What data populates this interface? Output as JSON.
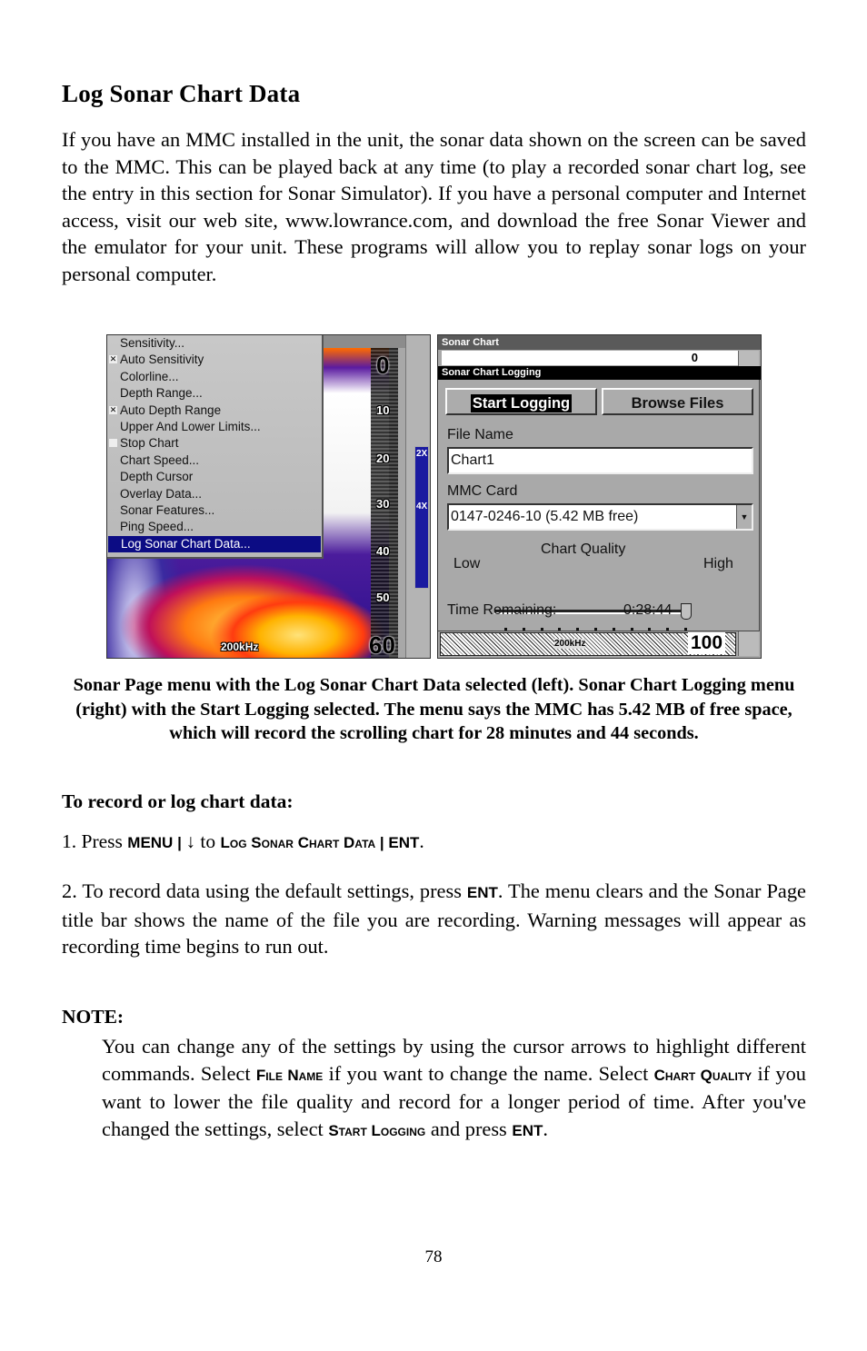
{
  "page": {
    "title": "Log Sonar Chart Data",
    "intro": "If you have an MMC installed in the unit, the sonar data shown on the screen can be saved to the MMC. This can be played back at any time (to play a recorded sonar chart log, see the entry in this section for Sonar Simulator). If you have a personal computer and Internet access, visit our web site, www.lowrance.com, and download the free Sonar Viewer and the emulator for your unit. These programs will allow you to replay sonar logs on your personal computer.",
    "caption": "Sonar Page menu with the Log Sonar Chart Data selected (left). Sonar Chart Logging menu (right) with the Start Logging selected. The menu says the MMC has 5.42 MB of free space, which will record the scrolling chart for 28 minutes and 44 seconds.",
    "subhead": "To record or log chart data:",
    "step1": {
      "prefix": "1. Press ",
      "key1": "MENU",
      "sep1": " | ",
      "arrow": "↓",
      "mid": " to ",
      "key2": "Log Sonar Chart Data",
      "sep2": " | ",
      "key3": "ENT",
      "suffix": "."
    },
    "step2": {
      "prefix": "2. To record data using the default settings, press ",
      "key": "ENT",
      "suffix": ". The menu clears and the Sonar Page title bar shows the name of the file you are recording. Warning messages will appear as recording time begins to run out."
    },
    "note": {
      "heading": "NOTE:",
      "t1": "You can change any of the settings by using the cursor arrows to highlight different commands. Select ",
      "k1": "File Name",
      "t2": " if you want to change the name. Select ",
      "k2": "Chart Quality",
      "t3": " if you want to lower the file quality and record for a longer period of time. After you've changed the settings, select ",
      "k3": "Start Logging",
      "t4": " and press ",
      "k4": "ENT",
      "t5": "."
    },
    "page_number": "78"
  },
  "left_screen": {
    "menu_items": [
      {
        "label": "Sensitivity...",
        "checkbox": null
      },
      {
        "label": "Auto Sensitivity",
        "checkbox": "checked"
      },
      {
        "label": "Colorline...",
        "checkbox": null
      },
      {
        "label": "Depth Range...",
        "checkbox": null
      },
      {
        "label": "Auto Depth Range",
        "checkbox": "checked"
      },
      {
        "label": "Upper And Lower Limits...",
        "checkbox": null
      },
      {
        "label": "Stop Chart",
        "checkbox": "unchecked"
      },
      {
        "label": "Chart Speed...",
        "checkbox": null
      },
      {
        "label": "Depth Cursor",
        "checkbox": null
      },
      {
        "label": "Overlay Data...",
        "checkbox": null
      },
      {
        "label": "Sonar Features...",
        "checkbox": null
      },
      {
        "label": "Ping Speed...",
        "checkbox": null
      },
      {
        "label": "Log Sonar Chart Data...",
        "checkbox": null,
        "selected": true
      }
    ],
    "depth_labels": [
      "0",
      "10",
      "20",
      "30",
      "40",
      "50",
      "60"
    ],
    "zoom_labels": [
      "2X",
      "4X"
    ],
    "frequency": "200kHz",
    "highlight_color": "#0c0c84"
  },
  "right_screen": {
    "window_title": "Sonar Chart",
    "background_depth_top": "0",
    "dialog_title": "Sonar Chart Logging",
    "start_logging_label": "Start Logging",
    "browse_files_label": "Browse Files",
    "file_name_label": "File Name",
    "file_name_value": "Chart1",
    "mmc_card_label": "MMC Card",
    "mmc_card_value": "0147-0246-10 (5.42 MB free)",
    "chart_quality_label": "Chart Quality",
    "quality_low_label": "Low",
    "quality_high_label": "High",
    "quality_level": 11,
    "quality_levels_total": 11,
    "time_remaining_label": "Time Remaining:",
    "time_remaining_value": "0:28:44",
    "frequency": "200kHz",
    "depth_bottom": "100"
  }
}
